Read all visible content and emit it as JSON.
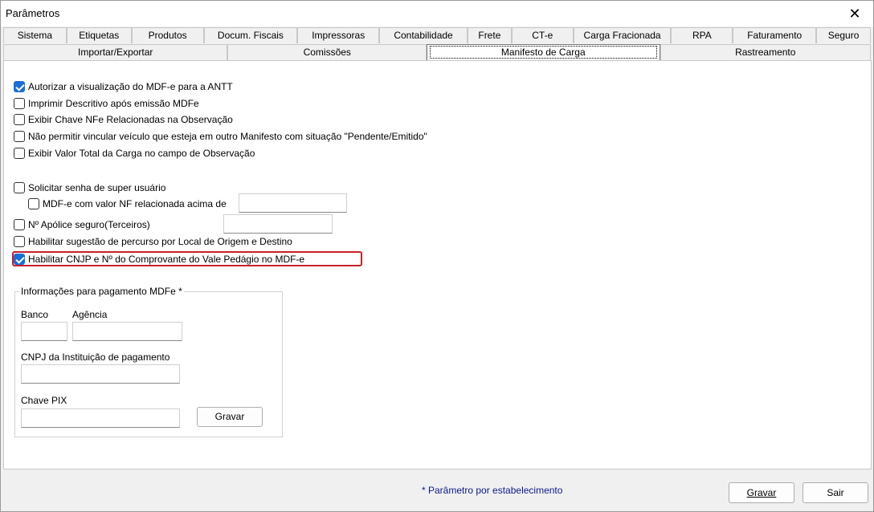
{
  "window": {
    "title": "Parâmetros"
  },
  "tabs_row1": [
    "Sistema",
    "Etiquetas",
    "Produtos",
    "Docum. Fiscais",
    "Impressoras",
    "Contabilidade",
    "Frete",
    "CT-e",
    "Carga Fracionada",
    "RPA",
    "Faturamento",
    "Seguro"
  ],
  "tabs_row2": [
    "Importar/Exportar",
    "Comissões",
    "Manifesto de Carga",
    "Rastreamento"
  ],
  "active_tab": "Manifesto de Carga",
  "options": {
    "opt1": {
      "label": "Autorizar a visualização do MDF-e para a ANTT",
      "checked": true
    },
    "opt2": {
      "label": "Imprimir Descritivo após emissão MDFe",
      "checked": false
    },
    "opt3": {
      "label": "Exibir Chave NFe Relacionadas na Observação",
      "checked": false
    },
    "opt4": {
      "label": "Não permitir vincular veículo que esteja em outro Manifesto com situação \"Pendente/Emitido\"",
      "checked": false
    },
    "opt5": {
      "label": "Exibir Valor Total da Carga no campo de Observação",
      "checked": false
    },
    "opt6": {
      "label": "Solicitar senha de super usuário",
      "checked": false
    },
    "opt7": {
      "label": "MDF-e com valor NF relacionada acima de",
      "checked": false
    },
    "opt8": {
      "label": "Nº Apólice seguro(Terceiros)",
      "checked": false
    },
    "opt9": {
      "label": "Habilitar sugestão de percurso por Local de Origem e Destino",
      "checked": false
    },
    "opt10": {
      "label": "Habilitar CNJP e Nº do Comprovante do Vale Pedágio no MDF-e",
      "checked": true
    }
  },
  "payment": {
    "title": "Informações para pagamento MDFe *",
    "banco_label": "Banco",
    "agencia_label": "Agência",
    "cnpj_label": "CNPJ da Instituição de pagamento",
    "pix_label": "Chave PIX",
    "gravar_button": "Gravar",
    "banco_value": "",
    "agencia_value": "",
    "cnpj_value": "",
    "pix_value": ""
  },
  "footer": {
    "note": "* Parâmetro por estabelecimento",
    "gravar_button": "Gravar",
    "sair_button": "Sair"
  },
  "colors": {
    "checkbox_accent": "#1a6fd6",
    "highlight_border": "#c8202a",
    "note_text": "#0a1a8c"
  }
}
